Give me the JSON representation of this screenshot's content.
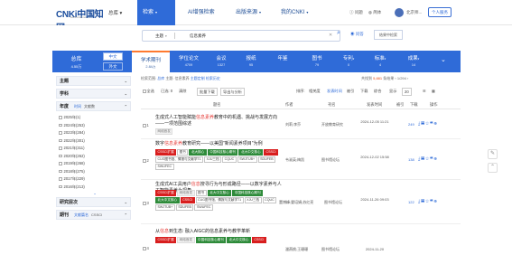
{
  "header": {
    "logo_text": "CNKi中国知网",
    "logo_sub": "www.cnki.net",
    "home": "总库",
    "nav": [
      {
        "label": "检索"
      },
      {
        "label": "AI增强检索"
      },
      {
        "label": "出版来源"
      },
      {
        "label": "我的CNKI"
      }
    ],
    "right": {
      "tip": "问题",
      "lang": "简体",
      "user": "北京师...",
      "personal_btn": "个人服务"
    }
  },
  "search": {
    "field": "主题",
    "query": "信息素养",
    "ai_label": "问答",
    "in_result": "结果中检索"
  },
  "band": {
    "total_label": "总库",
    "total_count": "4.55万",
    "lang_cn": "中文",
    "lang_en": "外文",
    "tabs": [
      {
        "name": "学术期刊",
        "count": "2.84万"
      },
      {
        "name": "学位论文",
        "count": "4709"
      },
      {
        "name": "会议",
        "count": "1327"
      },
      {
        "name": "报纸",
        "count": "95"
      },
      {
        "name": "年鉴",
        "count": ""
      },
      {
        "name": "图书",
        "count": "79"
      },
      {
        "name": "专利",
        "count": "0"
      },
      {
        "name": "标准",
        "count": "4"
      },
      {
        "name": "成果",
        "count": "14"
      }
    ]
  },
  "sidebar": {
    "sections": [
      {
        "label": "主题"
      },
      {
        "label": "学科"
      },
      {
        "label": "年度",
        "extra": "时间",
        "extra2": "文献数"
      }
    ],
    "years": [
      {
        "year": "2025年",
        "count": "(1)"
      },
      {
        "year": "2024年",
        "count": "(253)"
      },
      {
        "year": "2023年",
        "count": "(284)"
      },
      {
        "year": "2022年",
        "count": "(301)"
      },
      {
        "year": "2021年",
        "count": "(311)"
      },
      {
        "year": "2020年",
        "count": "(262)"
      },
      {
        "year": "2019年",
        "count": "(268)"
      },
      {
        "year": "2018年",
        "count": "(275)"
      },
      {
        "year": "2017年",
        "count": "(229)"
      },
      {
        "year": "2016年",
        "count": "(213)"
      }
    ],
    "bottom": [
      {
        "label": "研究层次"
      },
      {
        "label": "期刊",
        "extra": "文献篇名",
        "extra2": "CSSCI"
      }
    ]
  },
  "main": {
    "crumbs": {
      "prefix": "检索范围:",
      "a": "总库",
      "b": "主题: 信息素养",
      "c": "主题定制",
      "d": "检索历史"
    },
    "stats": {
      "label": "共找到",
      "count": "5,881",
      "unit": "条结果",
      "page": "1/294"
    },
    "toolbar": {
      "select_all": "全选",
      "selected": "已选: 0",
      "clear": "清除",
      "batch": "批量下载",
      "export": "导出与分析",
      "sort_label": "排序:",
      "sort1": "相关度",
      "sort2": "发表时间",
      "sort3": "被引",
      "sort4": "下载",
      "sort5": "综合",
      "show_label": "显示",
      "show_n": "20"
    },
    "headers": [
      "题名",
      "作者",
      "刊名",
      "发表时间",
      "被引",
      "下载",
      "操作"
    ],
    "rows": [
      {
        "idx": "1",
        "title_pre": "生成式人工智能赋能",
        "title_hl": "信息素养",
        "title_post": "教育中的机遇、挑战与发展方向——一项范围综述",
        "tags": [
          {
            "t": "网络首发",
            "k": "gy"
          }
        ],
        "author": "刘莉;李莎",
        "source": "开放教育研究",
        "date": "2024-12-05 11:21",
        "cite": "",
        "download": "249"
      },
      {
        "idx": "2",
        "title_pre": "数字",
        "title_hl": "信息素养",
        "title_post": "教育研究——以美国\"新闻素养项目\"为例",
        "tags": [
          {
            "t": "CSSCI扩展",
            "k": "r"
          },
          {
            "t": "图书",
            "k": ""
          },
          {
            "t": "北大核心",
            "k": "g"
          },
          {
            "t": "中国科技核心期刊",
            "k": "g"
          },
          {
            "t": "北大中文核心",
            "k": "g"
          },
          {
            "t": "CSSCI",
            "k": "r"
          },
          {
            "t": "CUG图书馆、情报与文献学T1",
            "k": ""
          },
          {
            "t": "XJU三档",
            "k": ""
          },
          {
            "t": "CQUC",
            "k": ""
          },
          {
            "t": "SWJTUB+",
            "k": ""
          },
          {
            "t": "SDUFEB",
            "k": ""
          },
          {
            "t": "SWUFEC",
            "k": ""
          }
        ],
        "author": "韦淑英;梅凯",
        "source": "图书馆论坛",
        "date": "2024-12-02 15:58",
        "cite": "",
        "download": "138"
      },
      {
        "idx": "3",
        "title_pre": "生成式AI工具用户",
        "title_hl": "信息",
        "title_post": "搜寻行为与形成路径——以数字素养与人工智能素养为视角",
        "tags": [
          {
            "t": "CSSCI扩展",
            "k": "r"
          },
          {
            "t": "网络首发",
            "k": "gy"
          },
          {
            "t": "图书",
            "k": ""
          },
          {
            "t": "北大中文核心",
            "k": "g"
          },
          {
            "t": "中国科技核心期刊",
            "k": "g"
          },
          {
            "t": "北大中文核心",
            "k": "g"
          },
          {
            "t": "CSSCI",
            "k": "r"
          },
          {
            "t": "CUG图书馆、情报与文献学T1",
            "k": ""
          },
          {
            "t": "XJU三档",
            "k": ""
          },
          {
            "t": "CQUC",
            "k": ""
          },
          {
            "t": "SWJTUB+",
            "k": ""
          },
          {
            "t": "SDUFEB",
            "k": ""
          },
          {
            "t": "SWUFEC",
            "k": ""
          }
        ],
        "author": "董博峰;晏培娟;苏红亮",
        "source": "图书馆论坛",
        "date": "2024-11-26 09:03",
        "cite": "",
        "download": "122"
      },
      {
        "idx": "4",
        "title_pre": "从",
        "title_hl": "信息",
        "title_post": "到生态: 融入AIGC的信息素养与教学革新",
        "tags": [
          {
            "t": "CSSCI扩展",
            "k": "r"
          },
          {
            "t": "网络首发",
            "k": "gy"
          },
          {
            "t": "中国科技核心期刊",
            "k": "g"
          },
          {
            "t": "北大中文核心",
            "k": "g"
          },
          {
            "t": "CSSCI",
            "k": "r"
          }
        ],
        "author": "潘燕桃;王珊珊",
        "source": "图书馆论坛",
        "date": "2024-11-20",
        "cite": "",
        "download": ""
      }
    ]
  }
}
